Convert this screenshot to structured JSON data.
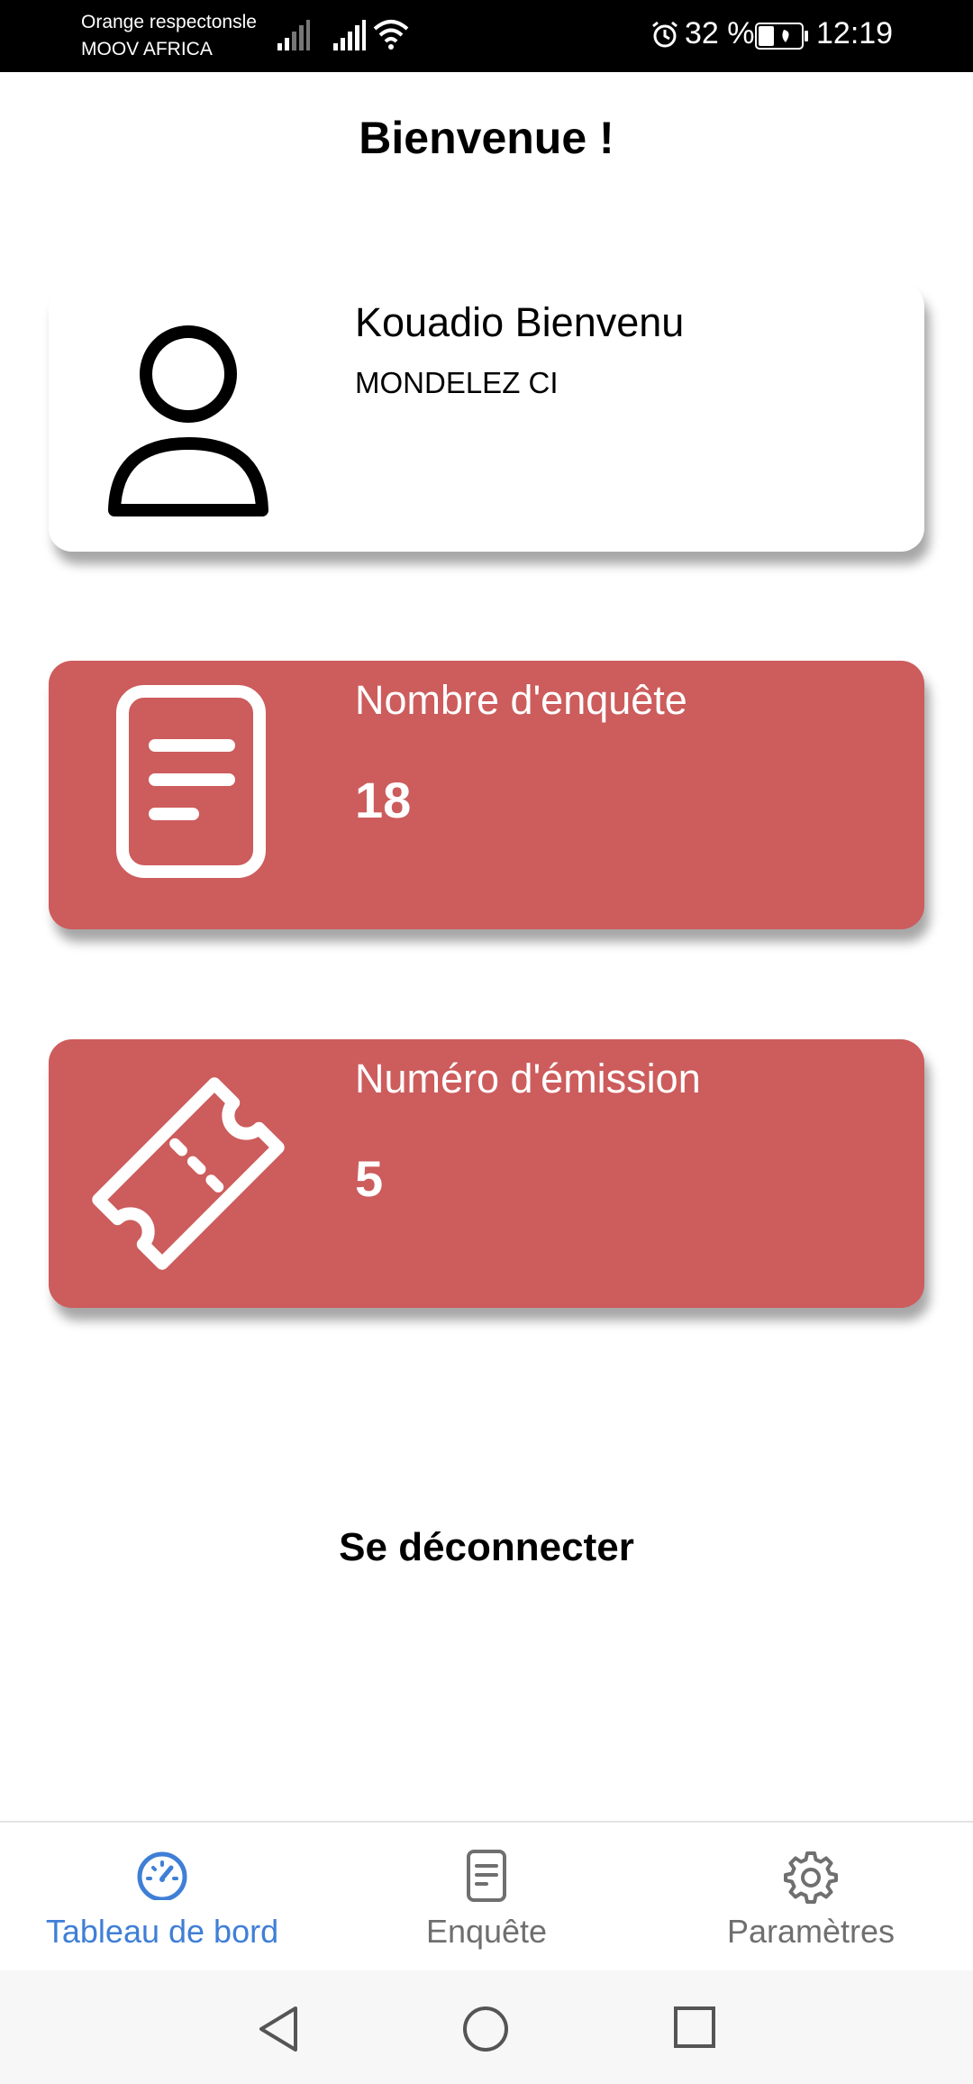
{
  "status_bar": {
    "carrier_1": "Orange respectonsle",
    "carrier_2": "MOOV AFRICA",
    "battery": "32 %",
    "time": "12:19",
    "icons": [
      "signal-icon",
      "signal-icon",
      "wifi-icon",
      "alarm-icon",
      "battery-icon"
    ]
  },
  "header": {
    "title": "Bienvenue !"
  },
  "profile": {
    "name": "Kouadio Bienvenu",
    "company": "MONDELEZ CI",
    "icon": "user-icon"
  },
  "stats": {
    "surveys": {
      "label": "Nombre d'enquête",
      "value": "18",
      "icon": "document-icon"
    },
    "emission": {
      "label": "Numéro d'émission",
      "value": "5",
      "icon": "ticket-icon"
    }
  },
  "logout_label": "Se déconnecter",
  "bottom_nav": {
    "items": [
      {
        "label": "Tableau de bord",
        "icon": "dashboard-icon",
        "active": true
      },
      {
        "label": "Enquête",
        "icon": "document-icon",
        "active": false
      },
      {
        "label": "Paramètres",
        "icon": "gear-icon",
        "active": false
      }
    ]
  },
  "colors": {
    "accent": "#3f7fd6",
    "card_red": "#cd5c5c",
    "inactive": "#6f6f6f"
  }
}
